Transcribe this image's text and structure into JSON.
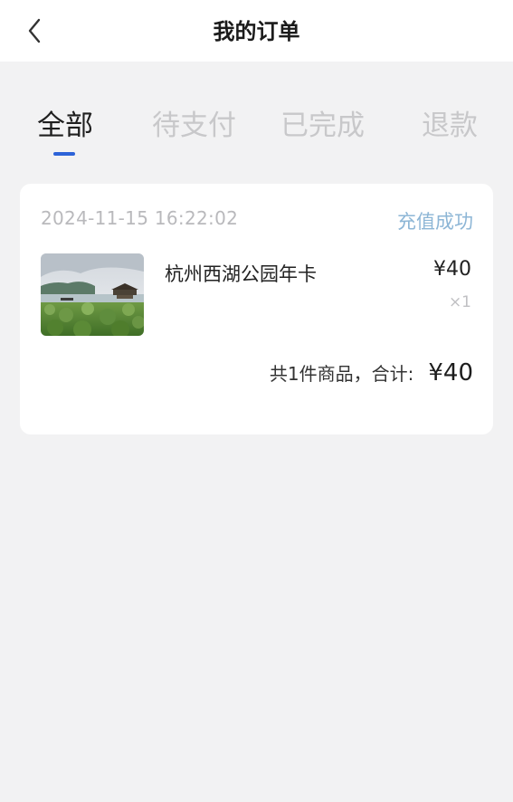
{
  "header": {
    "title": "我的订单",
    "back_icon": "chevron-left-icon"
  },
  "tabs": [
    {
      "label": "全部",
      "active": true
    },
    {
      "label": "待支付",
      "active": false
    },
    {
      "label": "已完成",
      "active": false
    },
    {
      "label": "退款",
      "active": false
    }
  ],
  "order": {
    "time": "2024-11-15 16:22:02",
    "status": "充值成功",
    "product": {
      "name": "杭州西湖公园年卡",
      "price": "¥40",
      "quantity": "×1",
      "thumbnail": "west-lake-lotus-photo"
    },
    "summary_label": "共1件商品，合计:",
    "total": "¥40"
  },
  "colors": {
    "background": "#f2f2f3",
    "card": "#ffffff",
    "accent": "#2d63d8",
    "status": "#8db6d6",
    "inactive_tab": "#c8c8ca"
  }
}
